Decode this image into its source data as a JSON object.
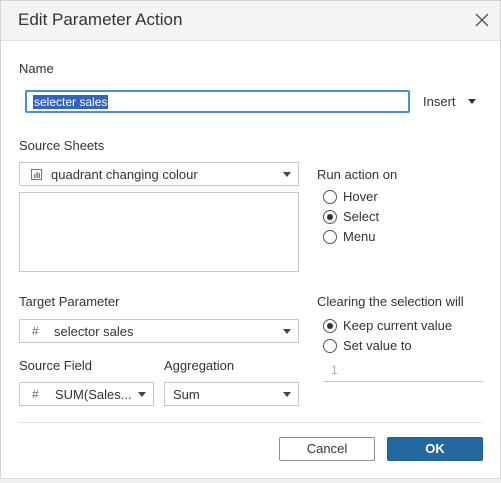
{
  "dialog": {
    "title": "Edit Parameter Action",
    "close_icon": "close-icon"
  },
  "name": {
    "label": "Name",
    "value": "selecter sales",
    "insert_label": "Insert"
  },
  "source_sheets": {
    "label": "Source Sheets",
    "selected": "quadrant changing colour",
    "icon": "bar-chart-icon"
  },
  "run_action": {
    "label": "Run action on",
    "options": [
      "Hover",
      "Select",
      "Menu"
    ],
    "selected": "Select"
  },
  "target_parameter": {
    "label": "Target Parameter",
    "selected": "selector sales",
    "icon": "hash-icon"
  },
  "clearing": {
    "label": "Clearing the selection will",
    "options": [
      "Keep current value",
      "Set value to"
    ],
    "selected": "Keep current value",
    "value": "1"
  },
  "source_field": {
    "label": "Source Field",
    "selected": "SUM(Sales...",
    "icon": "hash-icon"
  },
  "aggregation": {
    "label": "Aggregation",
    "selected": "Sum"
  },
  "buttons": {
    "cancel": "Cancel",
    "ok": "OK"
  },
  "colors": {
    "accent": "#23689e",
    "focus": "#4a90d9",
    "selection": "#2f63c4"
  }
}
